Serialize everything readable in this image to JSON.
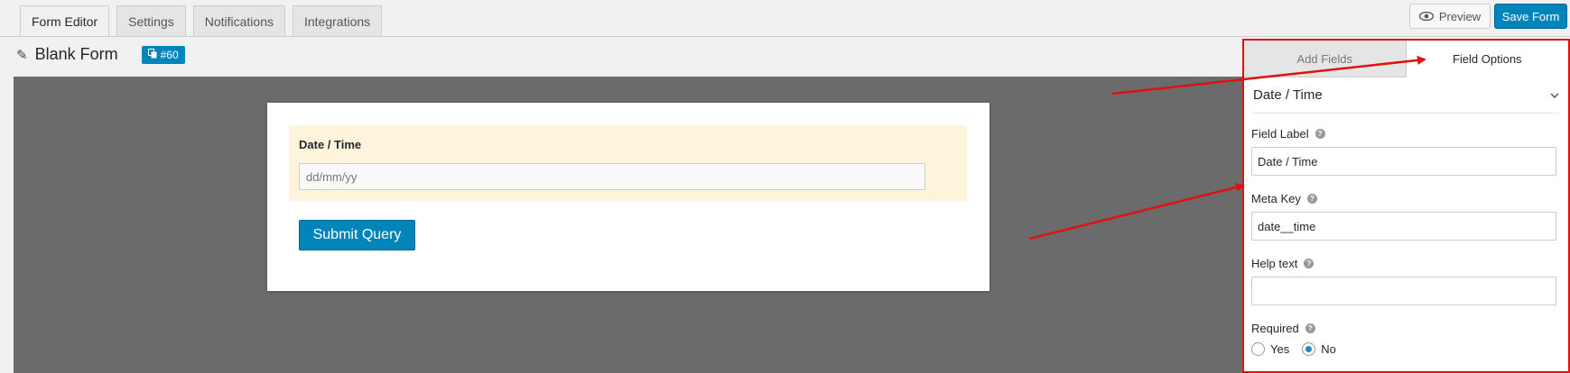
{
  "tabs": [
    "Form Editor",
    "Settings",
    "Notifications",
    "Integrations"
  ],
  "header": {
    "preview_label": "Preview",
    "save_label": "Save Form"
  },
  "form": {
    "title": "Blank Form",
    "id_label": "#60"
  },
  "preview": {
    "field_label": "Date / Time",
    "field_placeholder": "dd/mm/yy",
    "submit_label": "Submit Query"
  },
  "panel": {
    "tabs": [
      "Add Fields",
      "Field Options"
    ],
    "section_title": "Date / Time",
    "field_label": {
      "label": "Field Label",
      "value": "Date / Time"
    },
    "meta_key": {
      "label": "Meta Key",
      "value": "date__time"
    },
    "help_text": {
      "label": "Help text",
      "value": ""
    },
    "required": {
      "label": "Required",
      "options": [
        "Yes",
        "No"
      ],
      "selected": "No"
    }
  },
  "colors": {
    "accent": "#0085ba",
    "highlight": "#e21010",
    "field_bg": "#fef3db"
  },
  "icons": [
    "pencil-icon",
    "copy-icon",
    "eye-icon",
    "chevron-down-icon",
    "help-icon"
  ]
}
